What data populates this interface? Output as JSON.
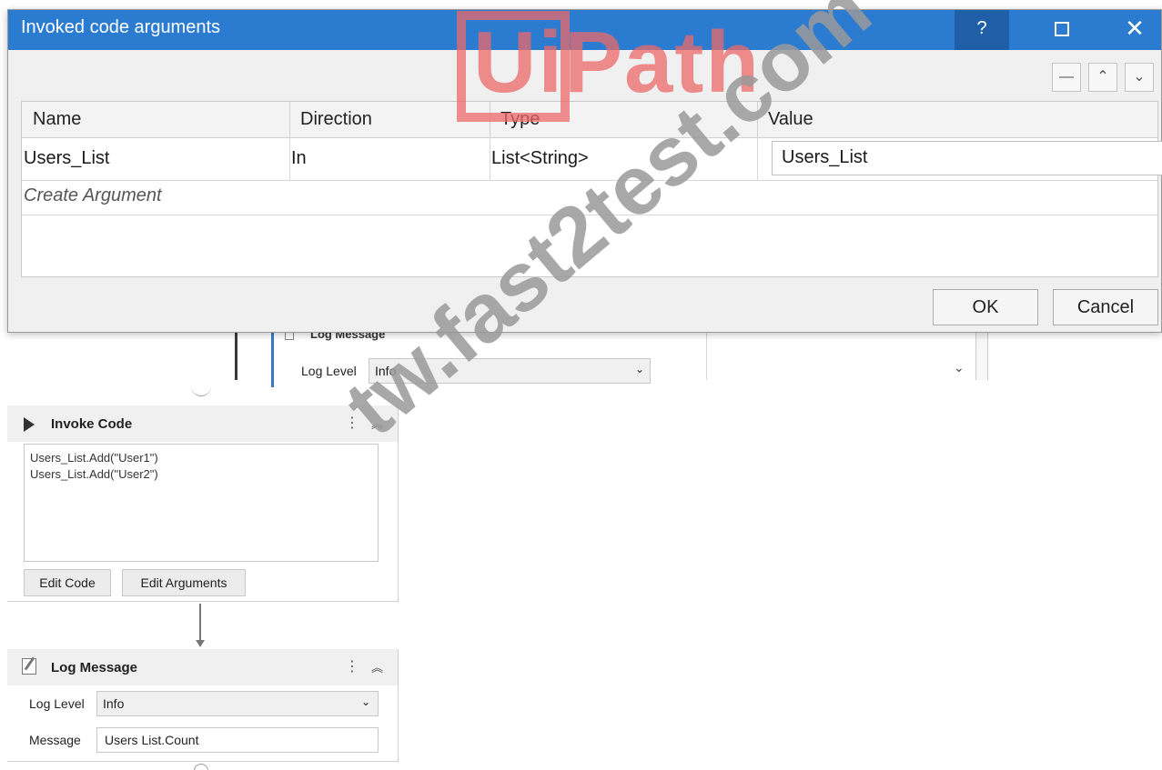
{
  "dialog": {
    "title": "Invoked code arguments",
    "help": "?",
    "close": "✕",
    "sort": {
      "delete": "—",
      "up": "⌃",
      "down": "⌄"
    },
    "columns": [
      "Name",
      "Direction",
      "Type",
      "Value"
    ],
    "rows": [
      {
        "name": "Users_List",
        "direction": "In",
        "type": "List<String>",
        "value": "Users_List"
      }
    ],
    "create_argument": "Create Argument",
    "ok": "OK",
    "cancel": "Cancel"
  },
  "background": {
    "log_message_partial": {
      "title": "Log Message",
      "level_label": "Log Level",
      "level_value": "Info",
      "chevron": "⌄"
    }
  },
  "invoke_code": {
    "title": "Invoke Code",
    "kebab": "⋮",
    "collapse": "︽",
    "code_lines": [
      "Users_List.Add(\"User1\")",
      "Users_List.Add(\"User2\")"
    ],
    "edit_code": "Edit Code",
    "edit_arguments": "Edit Arguments"
  },
  "log_message": {
    "title": "Log Message",
    "kebab": "⋮",
    "collapse": "︽",
    "level_label": "Log Level",
    "level_value": "Info",
    "chevron": "⌄",
    "message_label": "Message",
    "message_value": "Users List.Count"
  },
  "watermarks": {
    "logo": "UiPath",
    "site": "tw.fast2test.com"
  },
  "colors": {
    "titlebar": "#2b7bd0",
    "logo": "#ec6a6a",
    "watermark": "#9a9a9a"
  }
}
